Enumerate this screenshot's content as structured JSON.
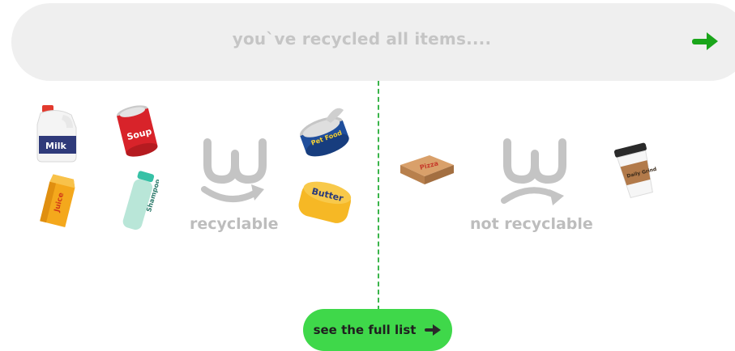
{
  "banner": {
    "message": "you`ve recycled all items....",
    "next_icon": "arrow-right-icon"
  },
  "colors": {
    "accent_green": "#3fd84a",
    "arrow_green": "#1aa51a",
    "divider_green": "#3ab54a",
    "muted_text": "#c5c5c5",
    "banner_bg": "#efefef"
  },
  "recyclable": {
    "label": "recyclable",
    "logo_icon": "w-recycle-logo-icon",
    "items": [
      {
        "name": "milk-jug",
        "text": "Milk"
      },
      {
        "name": "soup-can",
        "text": "Soup"
      },
      {
        "name": "pet-food-can",
        "text": "Pet Food"
      },
      {
        "name": "juice-carton",
        "text": "Juice"
      },
      {
        "name": "shampoo-bottle",
        "text": "Shampoo"
      },
      {
        "name": "butter-tub",
        "text": "Butter"
      }
    ]
  },
  "not_recyclable": {
    "label": "not recyclable",
    "logo_icon": "w-frown-logo-icon",
    "items": [
      {
        "name": "pizza-box",
        "text": "Pizza"
      },
      {
        "name": "coffee-cup",
        "text": "Daily Grind"
      }
    ]
  },
  "cta": {
    "label": "see the full list",
    "icon": "arrow-right-icon"
  }
}
